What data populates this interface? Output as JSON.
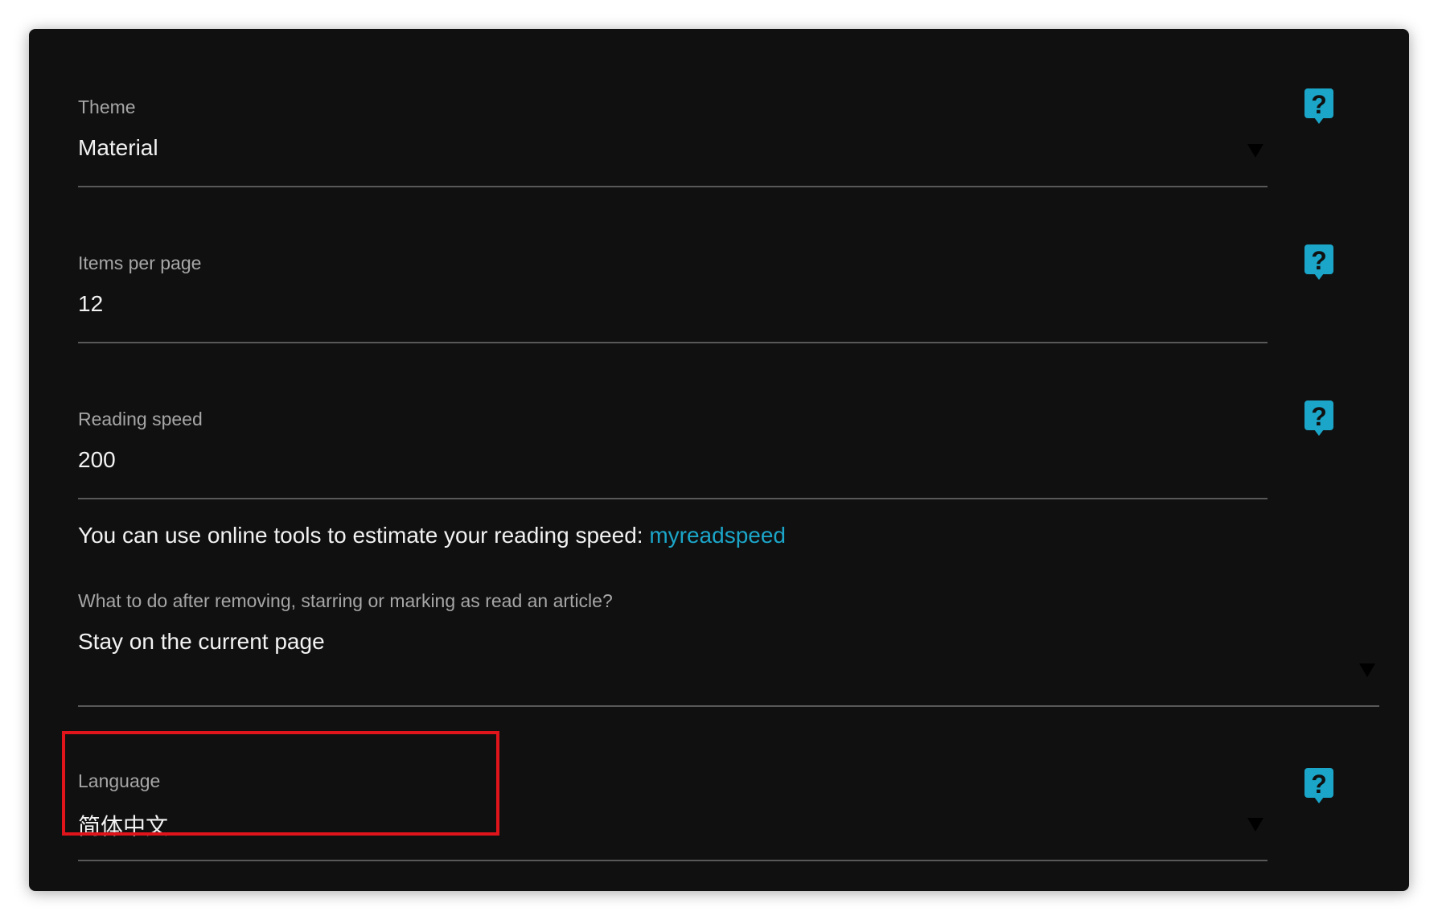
{
  "settings": {
    "theme": {
      "label": "Theme",
      "value": "Material"
    },
    "items_per_page": {
      "label": "Items per page",
      "value": "12"
    },
    "reading_speed": {
      "label": "Reading speed",
      "value": "200"
    },
    "reading_speed_hint": {
      "text": "You can use online tools to estimate your reading speed: ",
      "link_label": "myreadspeed"
    },
    "after_action": {
      "label": "What to do after removing, starring or marking as read an article?",
      "value": "Stay on the current page"
    },
    "language": {
      "label": "Language",
      "value": "简体中文"
    }
  },
  "icons": {
    "help": "help-question-icon",
    "dropdown": "caret-down-icon"
  },
  "colors": {
    "panel_background": "#101010",
    "accent": "#1ba6c9",
    "label_text": "#a6a6a6",
    "value_text": "#f2f2f2",
    "highlight_border": "#e0141b"
  }
}
